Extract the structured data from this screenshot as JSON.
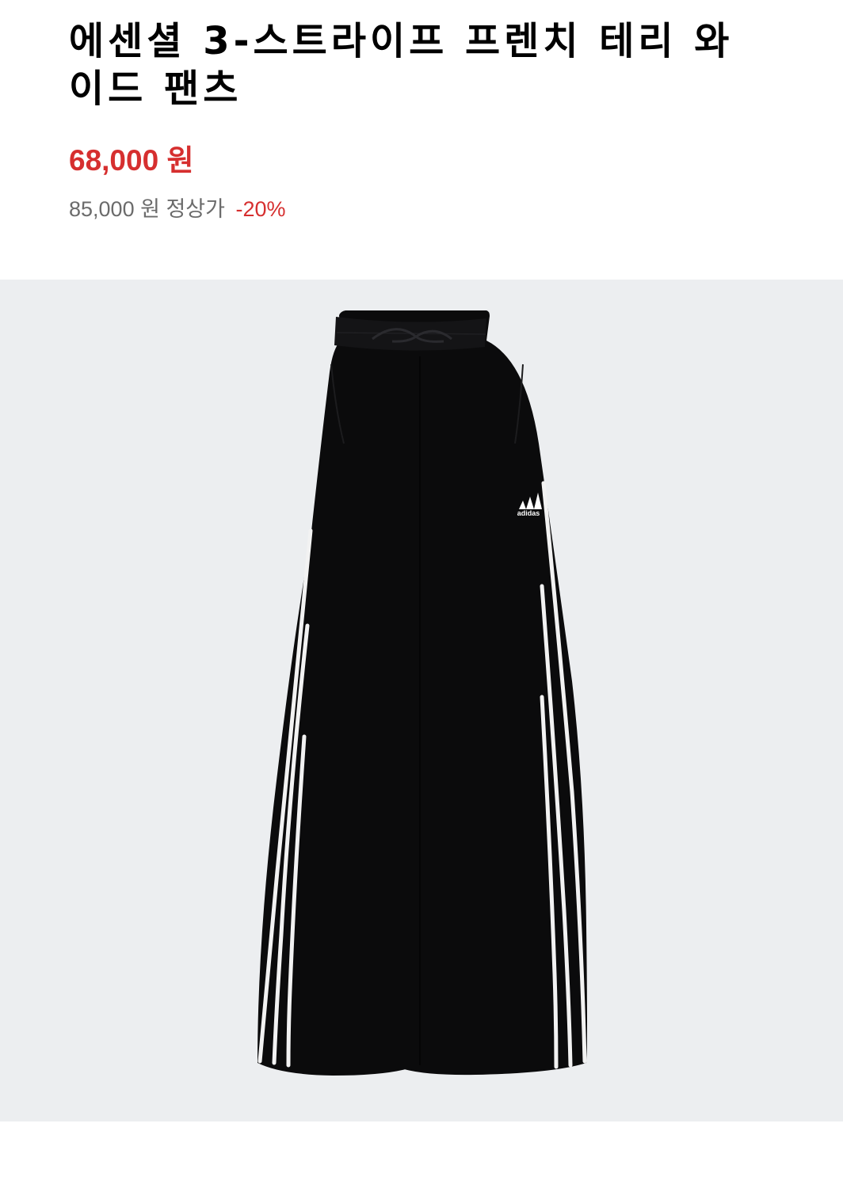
{
  "product": {
    "title_line1": "에센셜 3-스트라이프 프렌치 테리 와",
    "title_line2": "이드 팬츠",
    "sale_price": "68,000 원",
    "original_price": "85,000 원",
    "original_price_label": "정상가",
    "discount": "-20%"
  },
  "image": {
    "logo_text": "adidas",
    "background_color": "#eceef0",
    "garment_color": "#0b0b0c",
    "stripe_color": "#f2f2f2"
  },
  "colors": {
    "sale": "#d62f2f",
    "muted": "#6b6b6b",
    "title": "#000000"
  }
}
